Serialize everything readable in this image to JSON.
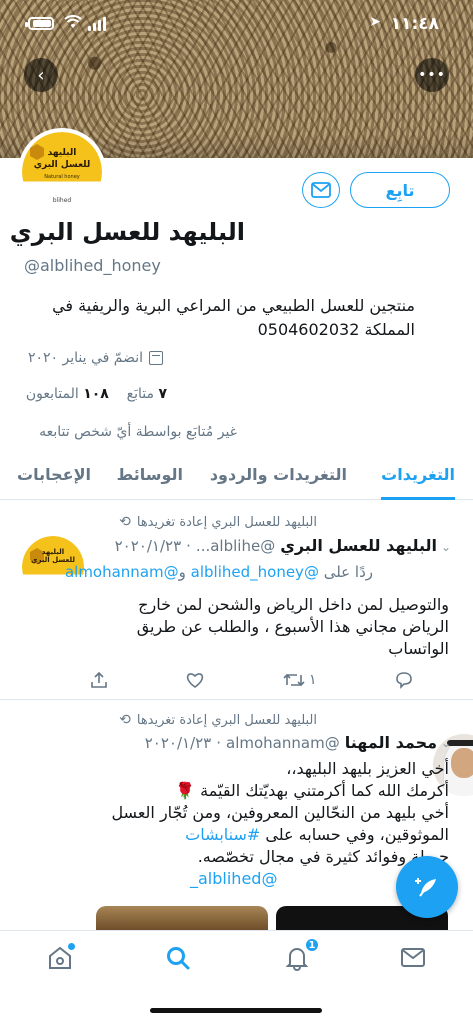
{
  "status_bar": {
    "time": "١١:٤٨"
  },
  "profile": {
    "name": "البليهد للعسل البري",
    "handle": "@alblihed_honey",
    "bio": "منتجين للعسل الطبيعي من المراعي البرية والريفية في المملكة 0504602032",
    "joined": "انضمّ في يناير ٢٠٢٠",
    "following_count": "٧",
    "following_label": "متابَع",
    "followers_count": "١٠٨",
    "followers_label": "المتابعون",
    "not_followed_text": "غير مُتابَع بواسطة أيّ شخص تتابعه",
    "follow_label": "تابِع"
  },
  "tabs": [
    {
      "label": "التغريدات"
    },
    {
      "label": "التغريدات والردود"
    },
    {
      "label": "الوسائط"
    },
    {
      "label": "الإعجابات"
    }
  ],
  "tweets": [
    {
      "retweet_context": "البليهد للعسل البري إعادة تغريدها",
      "name": "البليهد للعسل البري",
      "handle": "@alblihe...",
      "date": "٢٠٢٠/١/٢٣",
      "reply_prefix": "ردًا على",
      "reply_user1": "@alblihed_honey",
      "reply_joiner": "و",
      "reply_user2": "@almohannam",
      "text": "والتوصيل لمن داخل الرياض والشحن لمن خارج الرياض مجاني هذا الأسبوع ، والطلب عن طريق الواتساب",
      "retweet_count": "١"
    },
    {
      "retweet_context": "البليهد للعسل البري إعادة تغريدها",
      "name": "محمد المهنا",
      "handle": "@almohannam",
      "date": "٢٠٢٠/١/٢٣",
      "line1": "أخي العزيز بليهد البليهد،،",
      "line2": "أكرمك الله كما أكرمتني بهديّتك القيّمة 🌹",
      "line3": "أخي بليهد من النحّالين المعروفين، ومن تُجّار العسل الموثوقين، وفي حسابه على",
      "hashtag": "#سنابشات",
      "line4": "جميلة وفوائد كثيرة في مجال تخصّصه.",
      "mention": "@alblihed_"
    }
  ],
  "nav": {
    "notifications_badge": "1"
  },
  "avatar_logo": {
    "line1": "البليهد",
    "line2": "للعسل البري",
    "line3": "Natural honey",
    "line4": "blihed"
  },
  "colors": {
    "accent": "#1da1f2",
    "text": "#14171a",
    "muted": "#657786"
  }
}
